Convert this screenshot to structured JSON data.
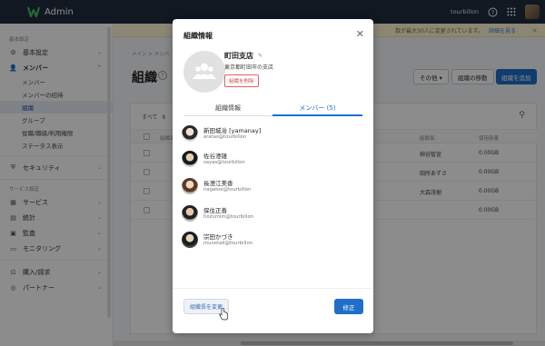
{
  "topbar": {
    "app_title": "Admin",
    "org_name": "tourbillon",
    "help_icon": "question-circle-icon",
    "apps_icon": "grid-icon"
  },
  "notice": {
    "text": "数が最大30人に変更されています。",
    "link": "詳細を見る"
  },
  "sidebar": {
    "section_basic": "基本設定",
    "basic": "基本設定",
    "members": "メンバー",
    "sub": [
      "メンバー",
      "メンバーの招待",
      "組織",
      "グループ",
      "役職/職級/利用権限",
      "ステータス表示"
    ],
    "security": "セキュリティ",
    "section_service": "サービス設定",
    "service": "サービス",
    "stats": "統計",
    "audit": "監査",
    "monitoring": "モニタリング",
    "purchase": "購入/請求",
    "partner": "パートナー"
  },
  "main": {
    "breadcrumb": "メイン  >  メンバ",
    "page_title": "組織",
    "btn_other": "その他 ▾",
    "btn_move": "組織の移動",
    "btn_add": "組織を追加",
    "all_label": "すべて",
    "all_count": "8",
    "col_org": "組織名",
    "col_leader": "組織長",
    "col_usage": "使用容量",
    "rows": [
      {
        "leader": "柳谷智宣",
        "usage": "0.00GB"
      },
      {
        "leader": "田所あずさ",
        "usage": "0.00GB"
      },
      {
        "leader": "大森茂樹",
        "usage": "0.00GB"
      },
      {
        "leader": "",
        "usage": "0.00GB"
      }
    ]
  },
  "modal": {
    "title": "組織情報",
    "org_name": "町田支店",
    "org_address": "東京都町田市の支店",
    "delete_label": "組織を削除",
    "tab_info": "組織情報",
    "tab_members": "メンバー (5)",
    "members": [
      {
        "name": "新田城治  [yamanay]",
        "email": "aratas@tourbillon"
      },
      {
        "name": "佐谷澄雄",
        "email": "sayas@tourbillon"
      },
      {
        "name": "長澄江美香",
        "email": "nagatoe@tourbillon"
      },
      {
        "name": "保住正善",
        "email": "hozumim@tourbillon"
      },
      {
        "name": "宗田かづき",
        "email": "munetak@tourbillon"
      }
    ],
    "change_leader": "組織長を変更",
    "save": "修正"
  },
  "colors": {
    "topbar": "#1f2d3d",
    "accent": "#1f6fc9",
    "danger": "#d04848"
  }
}
